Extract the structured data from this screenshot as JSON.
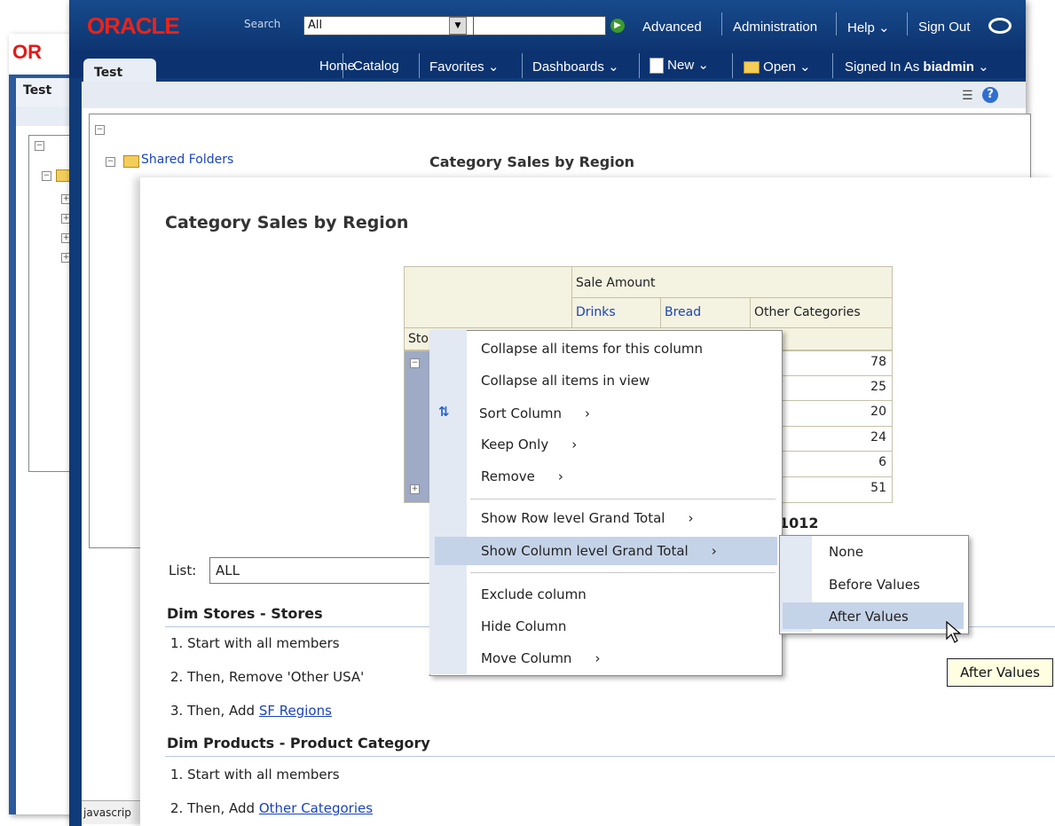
{
  "back_window": {
    "logo": "OR",
    "tab": "Test"
  },
  "main_window": {
    "logo": "ORACLE",
    "search_label": "Search",
    "search_scope": "All",
    "topnav": [
      "Advanced",
      "Administration",
      "Help",
      "Sign Out"
    ],
    "tab": "Test",
    "nav": [
      "Home",
      "Catalog",
      "Favorites",
      "Dashboards",
      "New",
      "Open"
    ],
    "signed_in_label": "Signed In As",
    "user": "biadmin",
    "tree_root": "Shared Folders",
    "status_text": "javascrip"
  },
  "report": {
    "title": "Category Sales by Region",
    "pivot": {
      "measure_header": "Sale Amount",
      "columns": [
        "Drinks",
        "Bread",
        "Other Categories"
      ],
      "row_header_partial": "Sto",
      "values": [
        "78",
        "25",
        "20",
        "24",
        "6",
        "51"
      ],
      "total_partial": "1012"
    },
    "list_label": "List:",
    "list_value": "ALL",
    "sections": [
      {
        "title": "Dim Stores - Stores",
        "steps": [
          "1. Start with all members",
          "2. Then, Remove 'Other USA'",
          "3. Then, Add "
        ],
        "link": "SF Regions"
      },
      {
        "title": "Dim Products - Product Category",
        "steps": [
          "1. Start with all members",
          "2. Then, Add "
        ],
        "link": "Other Categories"
      }
    ]
  },
  "context_menu": {
    "items": [
      "Collapse all items for this column",
      "Collapse all items in view",
      "Sort Column",
      "Keep Only",
      "Remove",
      "Show Row level Grand Total",
      "Show Column level Grand Total",
      "Exclude column",
      "Hide Column",
      "Move Column"
    ],
    "highlighted": "Show Column level Grand Total",
    "submenu": [
      "None",
      "Before Values",
      "After Values"
    ],
    "submenu_highlighted": "After Values",
    "tooltip": "After Values"
  },
  "colors": {
    "brand_red": "#e8241a",
    "header_blue": "#174a8c",
    "link_blue": "#1a44b8",
    "menu_highlight": "#c5d3e8"
  }
}
